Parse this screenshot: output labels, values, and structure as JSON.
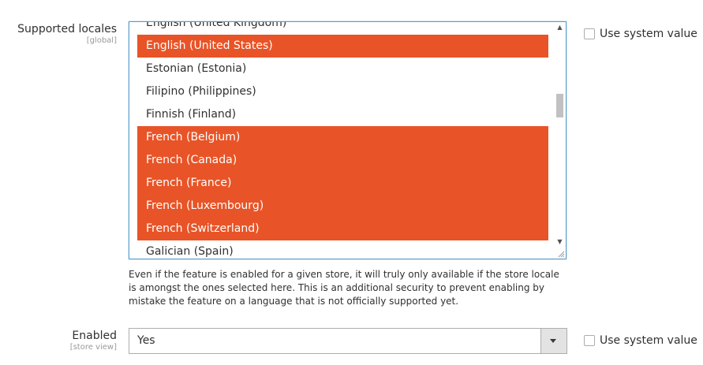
{
  "locales_field": {
    "label": "Supported locales",
    "scope": "[global]",
    "options": [
      {
        "label": "English (United Kingdom)",
        "selected": false
      },
      {
        "label": "English (United States)",
        "selected": true
      },
      {
        "label": "Estonian (Estonia)",
        "selected": false
      },
      {
        "label": "Filipino (Philippines)",
        "selected": false
      },
      {
        "label": "Finnish (Finland)",
        "selected": false
      },
      {
        "label": "French (Belgium)",
        "selected": true
      },
      {
        "label": "French (Canada)",
        "selected": true
      },
      {
        "label": "French (France)",
        "selected": true
      },
      {
        "label": "French (Luxembourg)",
        "selected": true
      },
      {
        "label": "French (Switzerland)",
        "selected": true
      },
      {
        "label": "Galician (Spain)",
        "selected": false
      }
    ],
    "use_system_value_label": "Use system value",
    "use_system_value_checked": false,
    "note": "Even if the feature is enabled for a given store, it will truly only available if the store locale is amongst the ones selected here. This is an additional security to prevent enabling by mistake the feature on a language that is not officially supported yet."
  },
  "enabled_field": {
    "label": "Enabled",
    "scope": "[store view]",
    "value": "Yes",
    "use_system_value_label": "Use system value",
    "use_system_value_checked": false
  },
  "colors": {
    "selected_option_bg": "#e85427",
    "selected_option_text": "#ffffff",
    "focus_border": "#5b9dc9"
  },
  "icons": {
    "scroll_up": "scroll-up-arrow-icon",
    "scroll_down": "scroll-down-arrow-icon",
    "select_caret": "chevron-down-icon",
    "resize": "resize-grip-icon"
  }
}
